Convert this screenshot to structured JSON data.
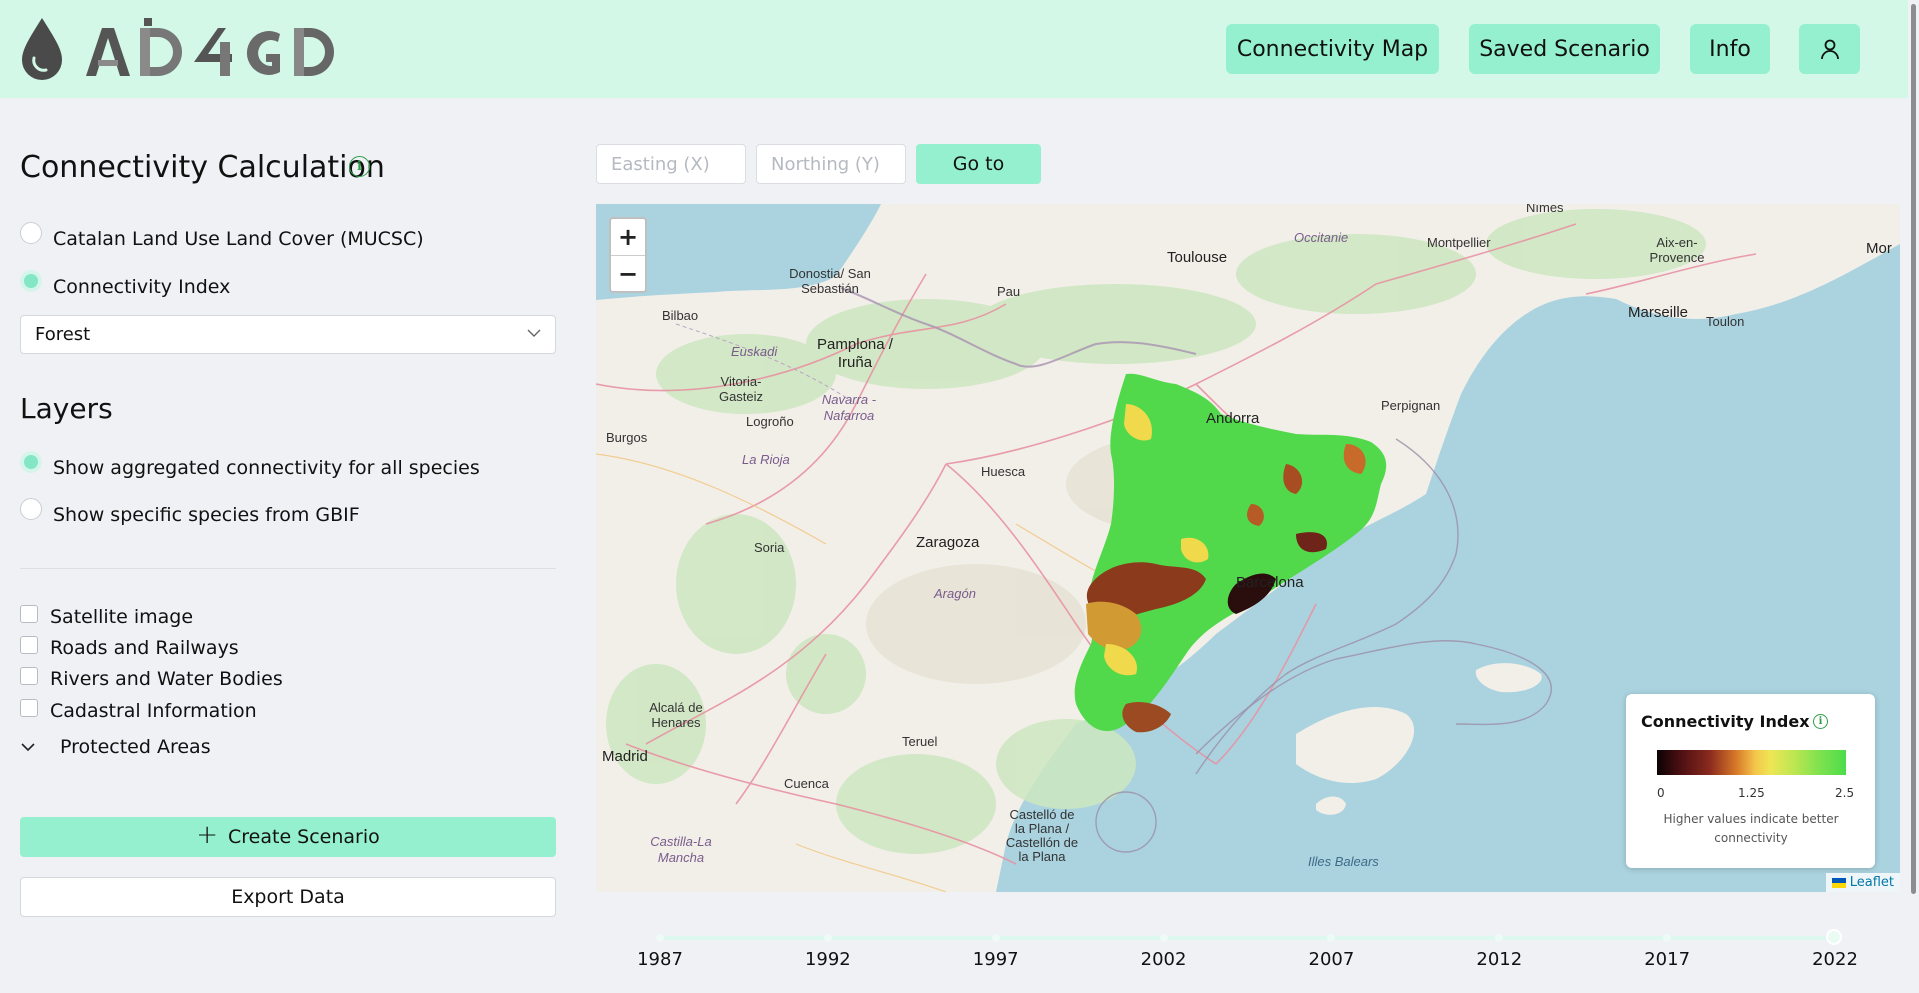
{
  "app": {
    "logo_text": "AD4GD"
  },
  "nav": {
    "connectivity_map": "Connectivity Map",
    "saved_scenario": "Saved Scenario",
    "info": "Info",
    "user_icon": "user-icon"
  },
  "sidebar": {
    "calc_title": "Connectivity Calculation",
    "calc_info_icon": "i",
    "options": [
      {
        "label": "Catalan Land Use Land Cover (MUCSC)",
        "selected": false
      },
      {
        "label": "Connectivity Index",
        "selected": true
      }
    ],
    "select_value": "Forest",
    "layers_title": "Layers",
    "layer_modes": [
      {
        "label": "Show aggregated connectivity for all species",
        "selected": true
      },
      {
        "label": "Show specific species from GBIF",
        "selected": false
      }
    ],
    "overlays": [
      {
        "label": "Satellite image",
        "checked": false
      },
      {
        "label": "Roads and Railways",
        "checked": false
      },
      {
        "label": "Rivers and Water Bodies",
        "checked": false
      },
      {
        "label": "Cadastral Information",
        "checked": false
      }
    ],
    "protected_areas": "Protected Areas",
    "create_scenario": "Create Scenario",
    "export_data": "Export Data"
  },
  "goto": {
    "easting_placeholder": "Easting (X)",
    "northing_placeholder": "Northing (Y)",
    "button": "Go to"
  },
  "map": {
    "zoom_in": "+",
    "zoom_out": "−",
    "places": [
      "Toulouse",
      "Nîmes",
      "Montpellier",
      "Aix-en-Provence",
      "Marseille",
      "Toulon",
      "Mor",
      "Occitanie",
      "Donostia/ San Sebastián",
      "Pau",
      "Bilbao",
      "Pamplona / Iruña",
      "Euskadi",
      "Vitoria-Gasteiz",
      "Navarra - Nafarroa",
      "Logroño",
      "La Rioja",
      "Burgos",
      "Andorra",
      "Perpignan",
      "Huesca",
      "Zaragoza",
      "Soria",
      "Aragón",
      "Barcelona",
      "Alcalá de Henares",
      "Madrid",
      "Teruel",
      "Cuenca",
      "Castelló de la Plana / Castellón de la Plana",
      "Castilla-La Mancha",
      "Illes Balears"
    ],
    "attribution": "Leaflet"
  },
  "legend": {
    "title": "Connectivity Index",
    "min": "0",
    "mid": "1.25",
    "max": "2.5",
    "note": "Higher values indicate better connectivity",
    "colors": [
      "#0b0204",
      "#8b2a1e",
      "#f4c64a",
      "#bfe651",
      "#4ddc4a"
    ]
  },
  "timeline": {
    "years": [
      "1987",
      "1992",
      "1997",
      "2002",
      "2007",
      "2012",
      "2017",
      "2022"
    ],
    "selected": "2022"
  },
  "colors": {
    "accent": "#94f0cf",
    "header_bg": "#d3f8e8",
    "page_bg": "#f0f1f4"
  }
}
